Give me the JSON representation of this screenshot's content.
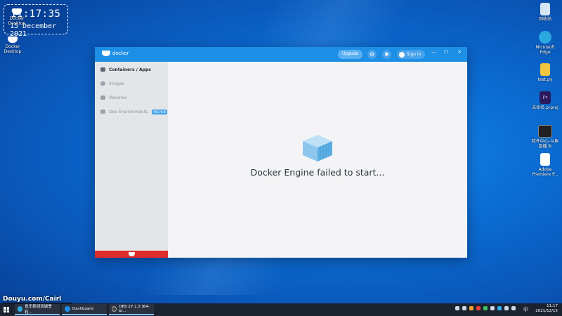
{
  "clock": {
    "time": "11:17:35",
    "date": "15 December 2021"
  },
  "desktop_left": [
    {
      "label": "Docker Desktop"
    },
    {
      "label": "Docker Desktop"
    }
  ],
  "desktop_right": [
    {
      "label": "回收站",
      "icon": "recycle-bin-icon",
      "color": "#d8e6f4"
    },
    {
      "label": "Microsoft Edge",
      "icon": "edge-icon",
      "color": "#2ba8e0"
    },
    {
      "label": "test.py",
      "icon": "python-file-icon",
      "color": "#f2c63c"
    },
    {
      "label": "未命名.prproj",
      "icon": "premiere-project-icon",
      "color": "#2a1a5e"
    },
    {
      "label": "软件中心-斗鱼直播.lk",
      "icon": "shortcut-icon",
      "color": "#202020"
    },
    {
      "label": "Adobe Premiere P...",
      "icon": "premiere-icon",
      "color": "#ffffff"
    }
  ],
  "window": {
    "logo_text": "docker",
    "upgrade_label": "Upgrade",
    "signin_label": "Sign in",
    "nav": [
      {
        "label": "Containers / Apps",
        "active": true
      },
      {
        "label": "Images",
        "active": false
      },
      {
        "label": "Volumes",
        "active": false
      },
      {
        "label": "Dev Environments",
        "active": false,
        "badge": "PREVIEW"
      }
    ],
    "message": "Docker Engine failed to start...",
    "status_color": "#e02c2c"
  },
  "watermark": "Douyu.com/Cairl",
  "taskbar": {
    "tasks": [
      {
        "label": "鱼乐新闻双城季 粒...",
        "color": "#2ba8e0"
      },
      {
        "label": "Dashboard",
        "color": "#1d8fe6"
      },
      {
        "label": "OBS 27.1.3 (64-bi...",
        "color": "#444444"
      }
    ],
    "ime": "中",
    "time": "11:17",
    "date": "2021/12/15"
  }
}
